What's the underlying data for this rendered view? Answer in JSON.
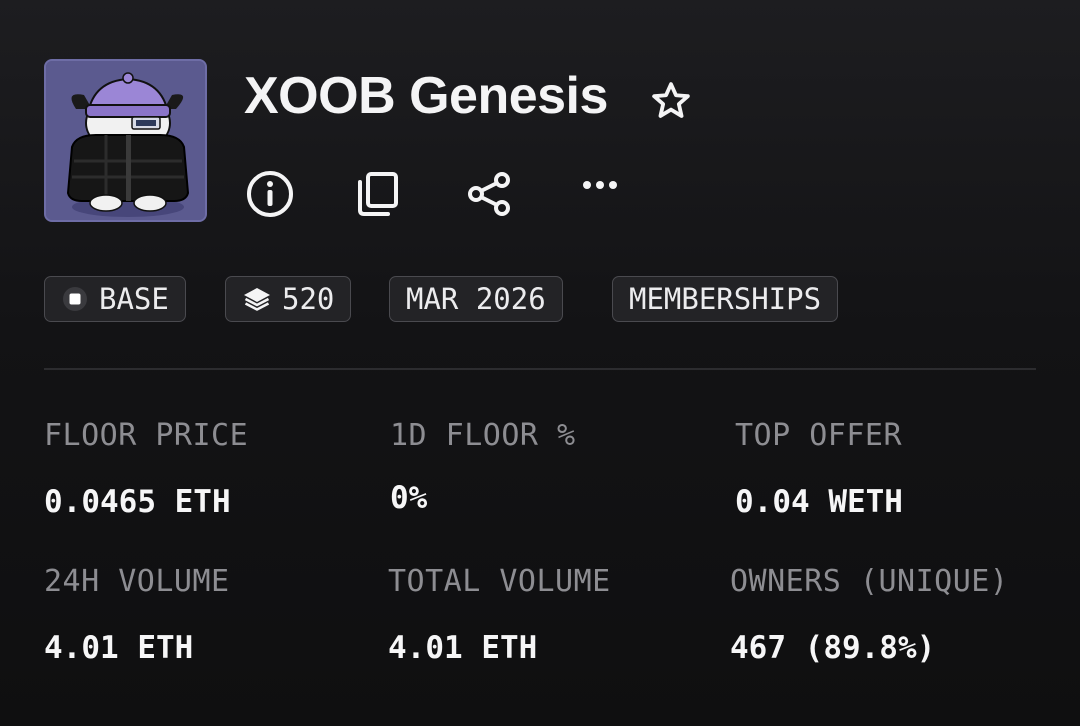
{
  "collection": {
    "name": "XOOB Genesis",
    "avatar_desc_icon": "xoob-character-avatar"
  },
  "actions": {
    "favorite_icon": "star-outline-icon",
    "info_icon": "info-icon",
    "copy_icon": "copy-icon",
    "share_icon": "share-icon",
    "more_icon": "more-horizontal-icon"
  },
  "chips": [
    {
      "label": "BASE",
      "icon": "base-chain-icon"
    },
    {
      "label": "520",
      "icon": "layers-icon"
    },
    {
      "label": "MAR 2026"
    },
    {
      "label": "MEMBERSHIPS"
    }
  ],
  "stats": {
    "floor_price": {
      "label": "FLOOR PRICE",
      "value": "0.0465 ETH"
    },
    "floor_change_1d": {
      "label": "1D FLOOR %",
      "value": "0%"
    },
    "top_offer": {
      "label": "TOP OFFER",
      "value": "0.04 WETH"
    },
    "volume_24h": {
      "label": "24H VOLUME",
      "value": "4.01 ETH"
    },
    "total_volume": {
      "label": "TOTAL VOLUME",
      "value": "4.01 ETH"
    },
    "owners": {
      "label": "OWNERS (UNIQUE)",
      "value": "467 (89.8%)"
    }
  },
  "colors": {
    "background": "#131315",
    "avatar_bg": "#5b5a8f",
    "chip_bg": "#232326",
    "chip_border": "#4a4a4f",
    "label_gray": "#8d8d92",
    "text_white": "#f4f4f5"
  }
}
